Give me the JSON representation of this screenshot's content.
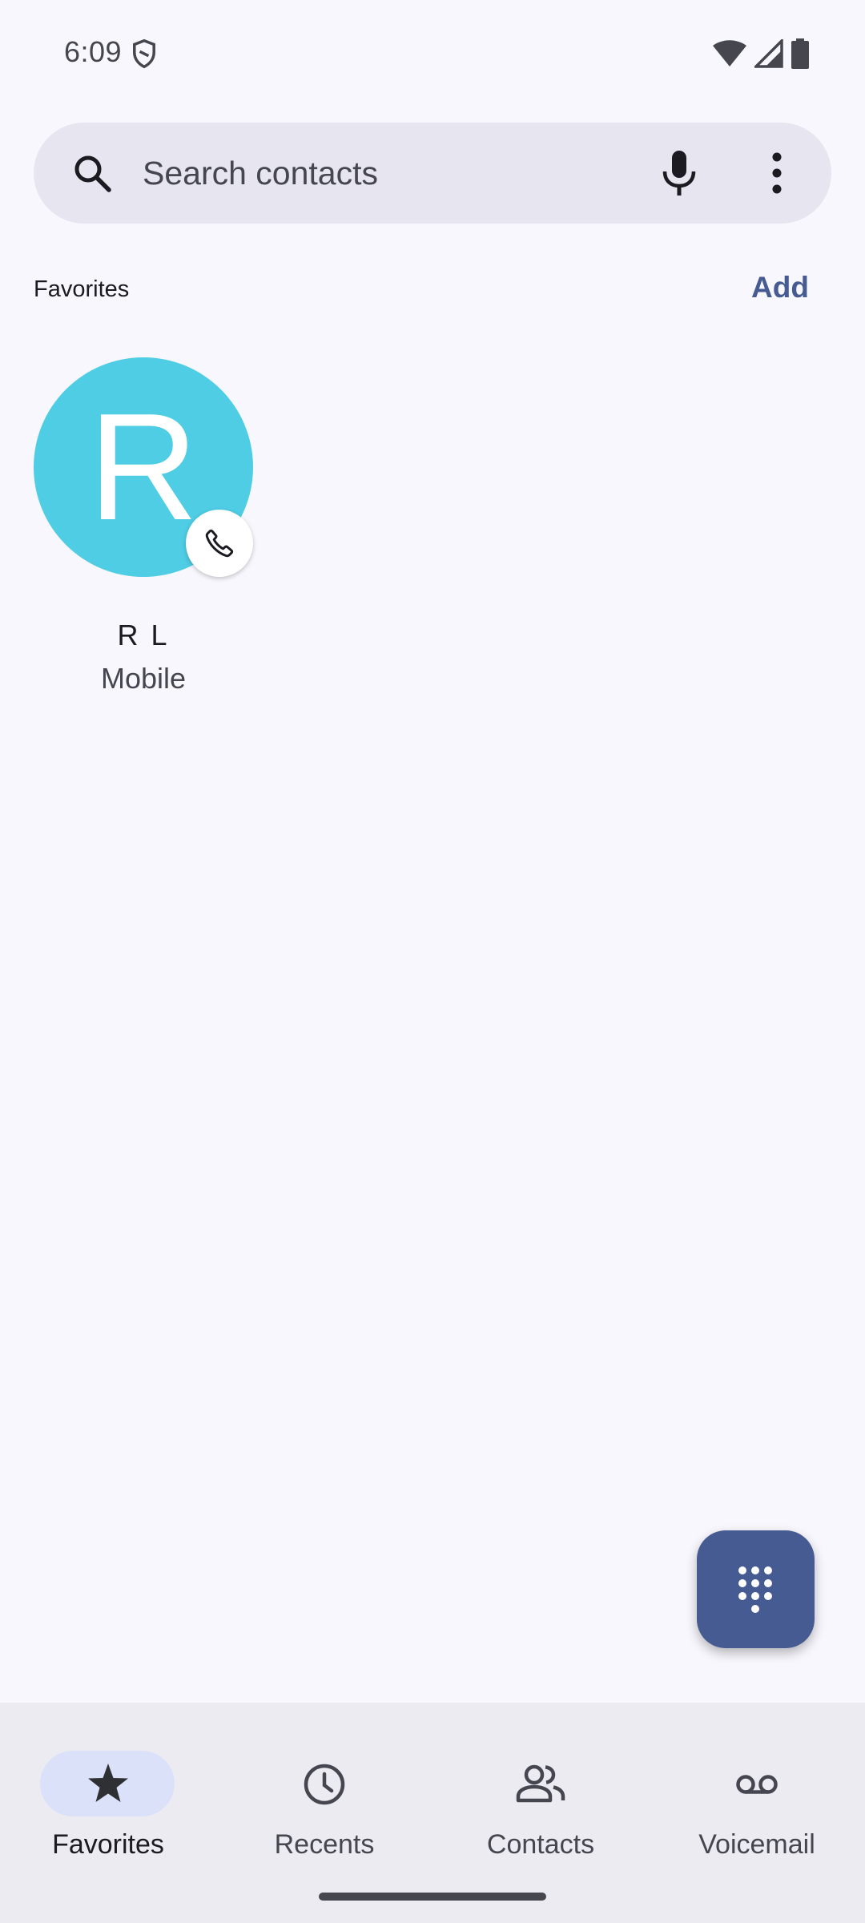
{
  "status_bar": {
    "time": "6:09",
    "icons": [
      "shield-icon",
      "wifi-icon",
      "signal-icon",
      "battery-icon"
    ]
  },
  "search": {
    "placeholder": "Search contacts",
    "icons": [
      "search-icon",
      "mic-icon",
      "more-vert-icon"
    ]
  },
  "favorites": {
    "title": "Favorites",
    "add_label": "Add",
    "items": [
      {
        "initial": "R",
        "name": "R L",
        "type": "Mobile",
        "avatar_color": "#4ecde4",
        "badge_icon": "phone-icon"
      }
    ]
  },
  "fab": {
    "icon": "dialpad-icon",
    "color": "#465b91"
  },
  "bottom_nav": {
    "items": [
      {
        "label": "Favorites",
        "icon": "star-icon",
        "active": true
      },
      {
        "label": "Recents",
        "icon": "clock-icon",
        "active": false
      },
      {
        "label": "Contacts",
        "icon": "people-icon",
        "active": false
      },
      {
        "label": "Voicemail",
        "icon": "voicemail-icon",
        "active": false
      }
    ]
  },
  "colors": {
    "background": "#f8f7fd",
    "accent": "#465b91",
    "active_pill": "#dbe1f9",
    "nav_background": "#ecebf2"
  }
}
